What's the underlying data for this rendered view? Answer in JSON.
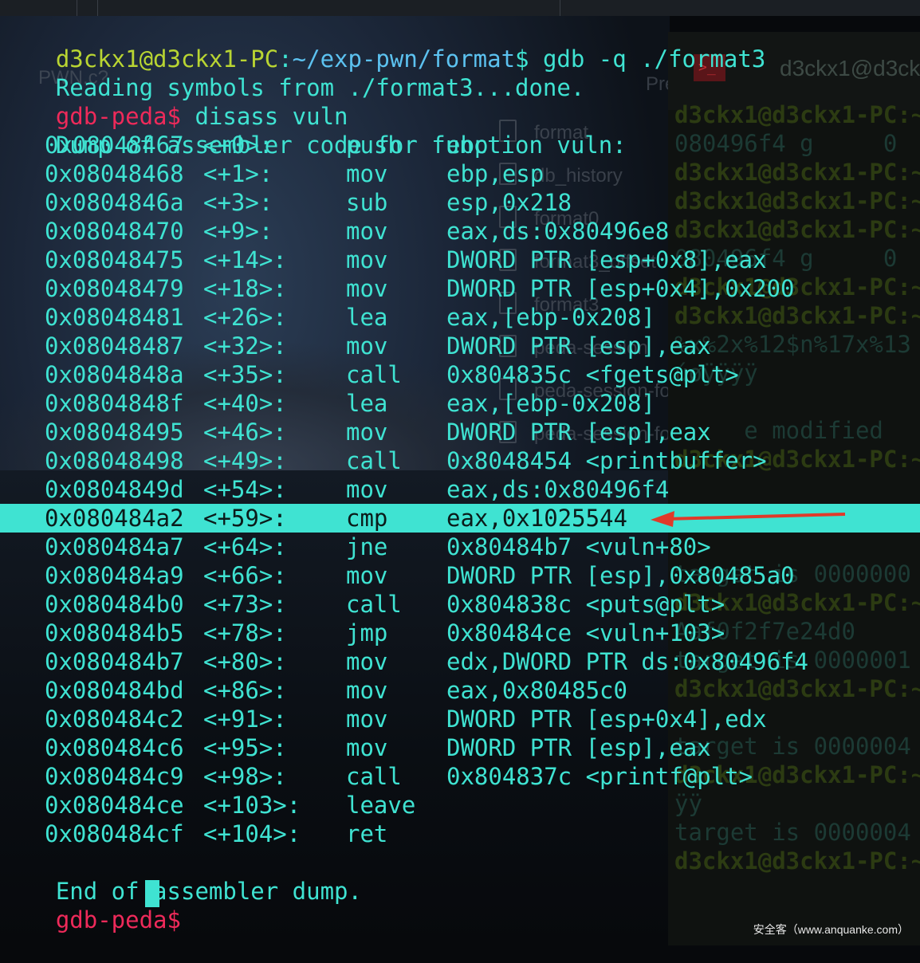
{
  "terminal": {
    "prompt_user": "d3ckx1@d3ckx1-PC",
    "prompt_sep": ":",
    "prompt_path": "~/exp-pwn/format",
    "prompt_dollar": "$",
    "command": " gdb -q ./format3",
    "reading": "Reading symbols from ./format3...done.",
    "gdb_prompt": "gdb-peda$",
    "disass_cmd": " disass vuln",
    "dump_header": "Dump of assembler code for function vuln:",
    "dump_footer": "End of assembler dump.",
    "instructions": [
      {
        "addr": "0x08048467",
        "off": "<+0>:",
        "mn": "push",
        "op": "ebp"
      },
      {
        "addr": "0x08048468",
        "off": "<+1>:",
        "mn": "mov",
        "op": "ebp,esp"
      },
      {
        "addr": "0x0804846a",
        "off": "<+3>:",
        "mn": "sub",
        "op": "esp,0x218"
      },
      {
        "addr": "0x08048470",
        "off": "<+9>:",
        "mn": "mov",
        "op": "eax,ds:0x80496e8"
      },
      {
        "addr": "0x08048475",
        "off": "<+14>:",
        "mn": "mov",
        "op": "DWORD PTR [esp+0x8],eax"
      },
      {
        "addr": "0x08048479",
        "off": "<+18>:",
        "mn": "mov",
        "op": "DWORD PTR [esp+0x4],0x200"
      },
      {
        "addr": "0x08048481",
        "off": "<+26>:",
        "mn": "lea",
        "op": "eax,[ebp-0x208]"
      },
      {
        "addr": "0x08048487",
        "off": "<+32>:",
        "mn": "mov",
        "op": "DWORD PTR [esp],eax"
      },
      {
        "addr": "0x0804848a",
        "off": "<+35>:",
        "mn": "call",
        "op": "0x804835c <fgets@plt>"
      },
      {
        "addr": "0x0804848f",
        "off": "<+40>:",
        "mn": "lea",
        "op": "eax,[ebp-0x208]"
      },
      {
        "addr": "0x08048495",
        "off": "<+46>:",
        "mn": "mov",
        "op": "DWORD PTR [esp],eax"
      },
      {
        "addr": "0x08048498",
        "off": "<+49>:",
        "mn": "call",
        "op": "0x8048454 <printbuffer>"
      },
      {
        "addr": "0x0804849d",
        "off": "<+54>:",
        "mn": "mov",
        "op": "eax,ds:0x80496f4"
      },
      {
        "addr": "0x080484a2",
        "off": "<+59>:",
        "mn": "cmp",
        "op": "eax,0x1025544",
        "highlighted": true
      },
      {
        "addr": "0x080484a7",
        "off": "<+64>:",
        "mn": "jne",
        "op": "0x80484b7 <vuln+80>"
      },
      {
        "addr": "0x080484a9",
        "off": "<+66>:",
        "mn": "mov",
        "op": "DWORD PTR [esp],0x80485a0"
      },
      {
        "addr": "0x080484b0",
        "off": "<+73>:",
        "mn": "call",
        "op": "0x804838c <puts@plt>"
      },
      {
        "addr": "0x080484b5",
        "off": "<+78>:",
        "mn": "jmp",
        "op": "0x80484ce <vuln+103>"
      },
      {
        "addr": "0x080484b7",
        "off": "<+80>:",
        "mn": "mov",
        "op": "edx,DWORD PTR ds:0x80496f4"
      },
      {
        "addr": "0x080484bd",
        "off": "<+86>:",
        "mn": "mov",
        "op": "eax,0x80485c0"
      },
      {
        "addr": "0x080484c2",
        "off": "<+91>:",
        "mn": "mov",
        "op": "DWORD PTR [esp+0x4],edx"
      },
      {
        "addr": "0x080484c6",
        "off": "<+95>:",
        "mn": "mov",
        "op": "DWORD PTR [esp],eax"
      },
      {
        "addr": "0x080484c9",
        "off": "<+98>:",
        "mn": "call",
        "op": "0x804837c <printf@plt>"
      },
      {
        "addr": "0x080484ce",
        "off": "<+103>:",
        "mn": "leave",
        "op": ""
      },
      {
        "addr": "0x080484cf",
        "off": "<+104>:",
        "mn": "ret",
        "op": ""
      }
    ]
  },
  "background_explorer": {
    "header_left": "PWN.c?",
    "header_right": "Pre",
    "files": [
      "format",
      "db_history",
      "format0",
      "format3_offset",
      "format3",
      "peda-session",
      "peda-session-fo",
      "peda-session-fo"
    ]
  },
  "right_terminal": {
    "title": "d3ckx1@d3ck",
    "icon": ">_",
    "lines": [
      {
        "kind": "prompt",
        "text": "d3ckx1@d3ckx1-PC:~"
      },
      {
        "kind": "text",
        "text": "080496f4 g     0"
      },
      {
        "kind": "prompt",
        "text": "d3ckx1@d3ckx1-PC:~"
      },
      {
        "kind": "prompt",
        "text": "d3ckx1@d3ckx1-PC:~"
      },
      {
        "kind": "prompt",
        "text": "d3ckx1@d3ckx1-PC:~"
      },
      {
        "kind": "text",
        "text": "080496f4 g     0"
      },
      {
        "kind": "prompt",
        "text": "d3ckx1@d3ckx1-PC:~"
      },
      {
        "kind": "prompt",
        "text": "d3ckx1@d3ckx1-PC:~"
      },
      {
        "kind": "text",
        "text": "%x%2x%12$n%17x%13"
      },
      {
        "kind": "text",
        "text": "úøÿÿÿÿ"
      },
      {
        "kind": "text",
        "text": ""
      },
      {
        "kind": "text",
        "text": "     e modified"
      },
      {
        "kind": "prompt",
        "text": "d3ckx1@d3ckx1-PC:~"
      },
      {
        "kind": "text",
        "text": ""
      },
      {
        "kind": "prompt",
        "text": "d3ckx1@d3ckx1-PC:~"
      },
      {
        "kind": "text",
        "text": ""
      },
      {
        "kind": "text",
        "text": "target is 0000000"
      },
      {
        "kind": "prompt",
        "text": "d3ckx1@d3ckx1-PC:~"
      },
      {
        "kind": "text",
        "text": "Aaf0f2f7e24d0"
      },
      {
        "kind": "text",
        "text": "target is 0000001"
      },
      {
        "kind": "prompt",
        "text": "d3ckx1@d3ckx1-PC:~"
      },
      {
        "kind": "text",
        "text": ""
      },
      {
        "kind": "text",
        "text": "target is 0000004"
      },
      {
        "kind": "prompt",
        "text": "d3ckx1@d3ckx1-PC:~"
      },
      {
        "kind": "text",
        "text": "ÿÿ"
      },
      {
        "kind": "text",
        "text": "target is 0000004"
      },
      {
        "kind": "prompt",
        "text": "d3ckx1@d3ckx1-PC:~"
      }
    ]
  },
  "watermark": "安全客（www.anquanke.com）",
  "colors": {
    "highlight": "#3fe3d2",
    "arrow": "#e03a2a",
    "prompt_user": "#b9d532",
    "prompt_path": "#5cc2f0",
    "gdb_prompt": "#ee2a5a"
  }
}
